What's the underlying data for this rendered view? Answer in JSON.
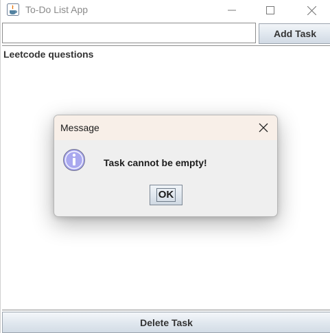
{
  "window": {
    "title": "To-Do List App",
    "controls": {
      "minimize_icon": "minimize-icon",
      "maximize_icon": "maximize-icon",
      "close_icon": "close-icon"
    }
  },
  "toolbar": {
    "task_input_value": "",
    "add_button_label": "Add Task"
  },
  "task_list": {
    "items": [
      "Leetcode questions"
    ]
  },
  "footer": {
    "delete_button_label": "Delete Task"
  },
  "dialog": {
    "title": "Message",
    "message": "Task cannot be empty!",
    "ok_label": "OK",
    "icon": "info-icon",
    "close_icon": "close-icon"
  },
  "colors": {
    "dialog_titlebar": "#f8efe8",
    "dialog_body": "#efefef",
    "info_icon_fill": "#a9a8ef"
  }
}
